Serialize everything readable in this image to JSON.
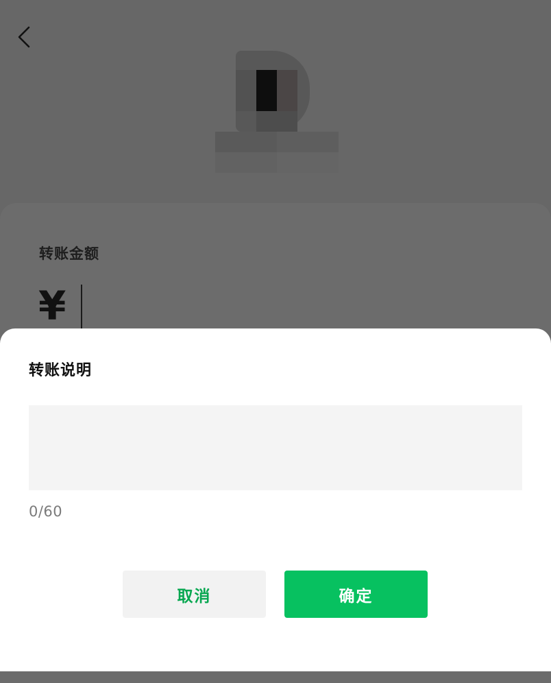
{
  "background": {
    "amount_label": "转账金额",
    "currency_symbol": "¥"
  },
  "dialog": {
    "title": "转账说明",
    "note_value": "",
    "char_counter": "0/60",
    "cancel_label": "取消",
    "confirm_label": "确定"
  },
  "icons": {
    "back": "chevron-left-icon",
    "avatar": "pixelated-avatar"
  },
  "colors": {
    "overlay_gray": "#676767",
    "sheet_bg": "#ffffff",
    "input_bg": "#f4f4f4",
    "accent_green": "#07c160",
    "cancel_text_green": "#07a750",
    "cancel_bg": "#f2f2f2",
    "counter_text": "#7a7a7a"
  }
}
